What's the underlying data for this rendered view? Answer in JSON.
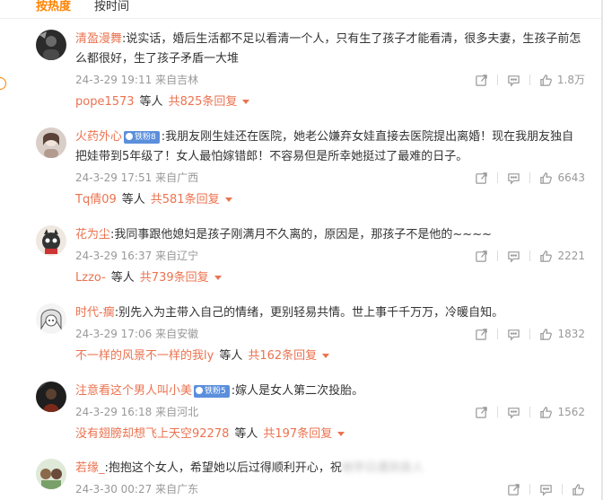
{
  "tabs": [
    {
      "label": "按热度",
      "active": true
    },
    {
      "label": "按时间",
      "active": false
    }
  ],
  "colors": {
    "accent": "#ff8200",
    "username": "#eb7350",
    "meta": "#999999",
    "badge": "#5b8fdc"
  },
  "comments": [
    {
      "user": "清盈漫舞",
      "badge": null,
      "text": "说实话，婚后生活都不足以看清一个人，只有生了孩子才能看清，很多夫妻，生孩子前怎么都很好，生了孩子矛盾一大堆",
      "time": "24-3-29 19:11",
      "location": "来自吉林",
      "likes": "1.8万",
      "replies": {
        "who": "pope1573",
        "etc": "等人",
        "total": "共825条回复"
      }
    },
    {
      "user": "火药外心",
      "badge": "铁粉8",
      "text": "我朋友刚生娃还在医院，她老公嫌弃女娃直接去医院提出离婚！现在我朋友独自把娃带到5年级了！女人最怕嫁错郎！不容易但是所幸她挺过了最难的日子。",
      "time": "24-3-29 17:51",
      "location": "来自广西",
      "likes": "6643",
      "replies": {
        "who": "Tq倩09",
        "etc": "等人",
        "total": "共581条回复"
      }
    },
    {
      "user": "花为尘",
      "badge": null,
      "text": "我同事跟他媳妇是孩子刚满月不久离的，原因是，那孩子不是他的~~~~",
      "time": "24-3-29 16:37",
      "location": "来自辽宁",
      "likes": "2221",
      "replies": {
        "who": "Lzzo-",
        "etc": "等人",
        "total": "共739条回复"
      }
    },
    {
      "user": "时代-瘸",
      "badge": null,
      "text": "别先入为主带入自己的情绪，更别轻易共情。世上事千千万万，冷暖自知。",
      "time": "24-3-29 17:06",
      "location": "来自安徽",
      "likes": "1832",
      "replies": {
        "who": "不一样的风景不一样的我ly",
        "etc": "等人",
        "total": "共162条回复"
      }
    },
    {
      "user": "注意看这个男人叫小美",
      "badge": "铁粉5",
      "text": "嫁人是女人第二次投胎。",
      "time": "24-3-29 16:18",
      "location": "来自河北",
      "likes": "1562",
      "replies": {
        "who": "没有翅膀却想飞上天空92278",
        "etc": "等人",
        "total": "共197条回复"
      }
    },
    {
      "user": "若缘_",
      "badge": null,
      "text": "抱抱这个女人，希望她以后过得顺利开心，祝",
      "text_blurred": "她早日遇到良人",
      "time": "24-3-30 00:27",
      "location": "来自广东",
      "likes": "",
      "replies": null
    }
  ]
}
